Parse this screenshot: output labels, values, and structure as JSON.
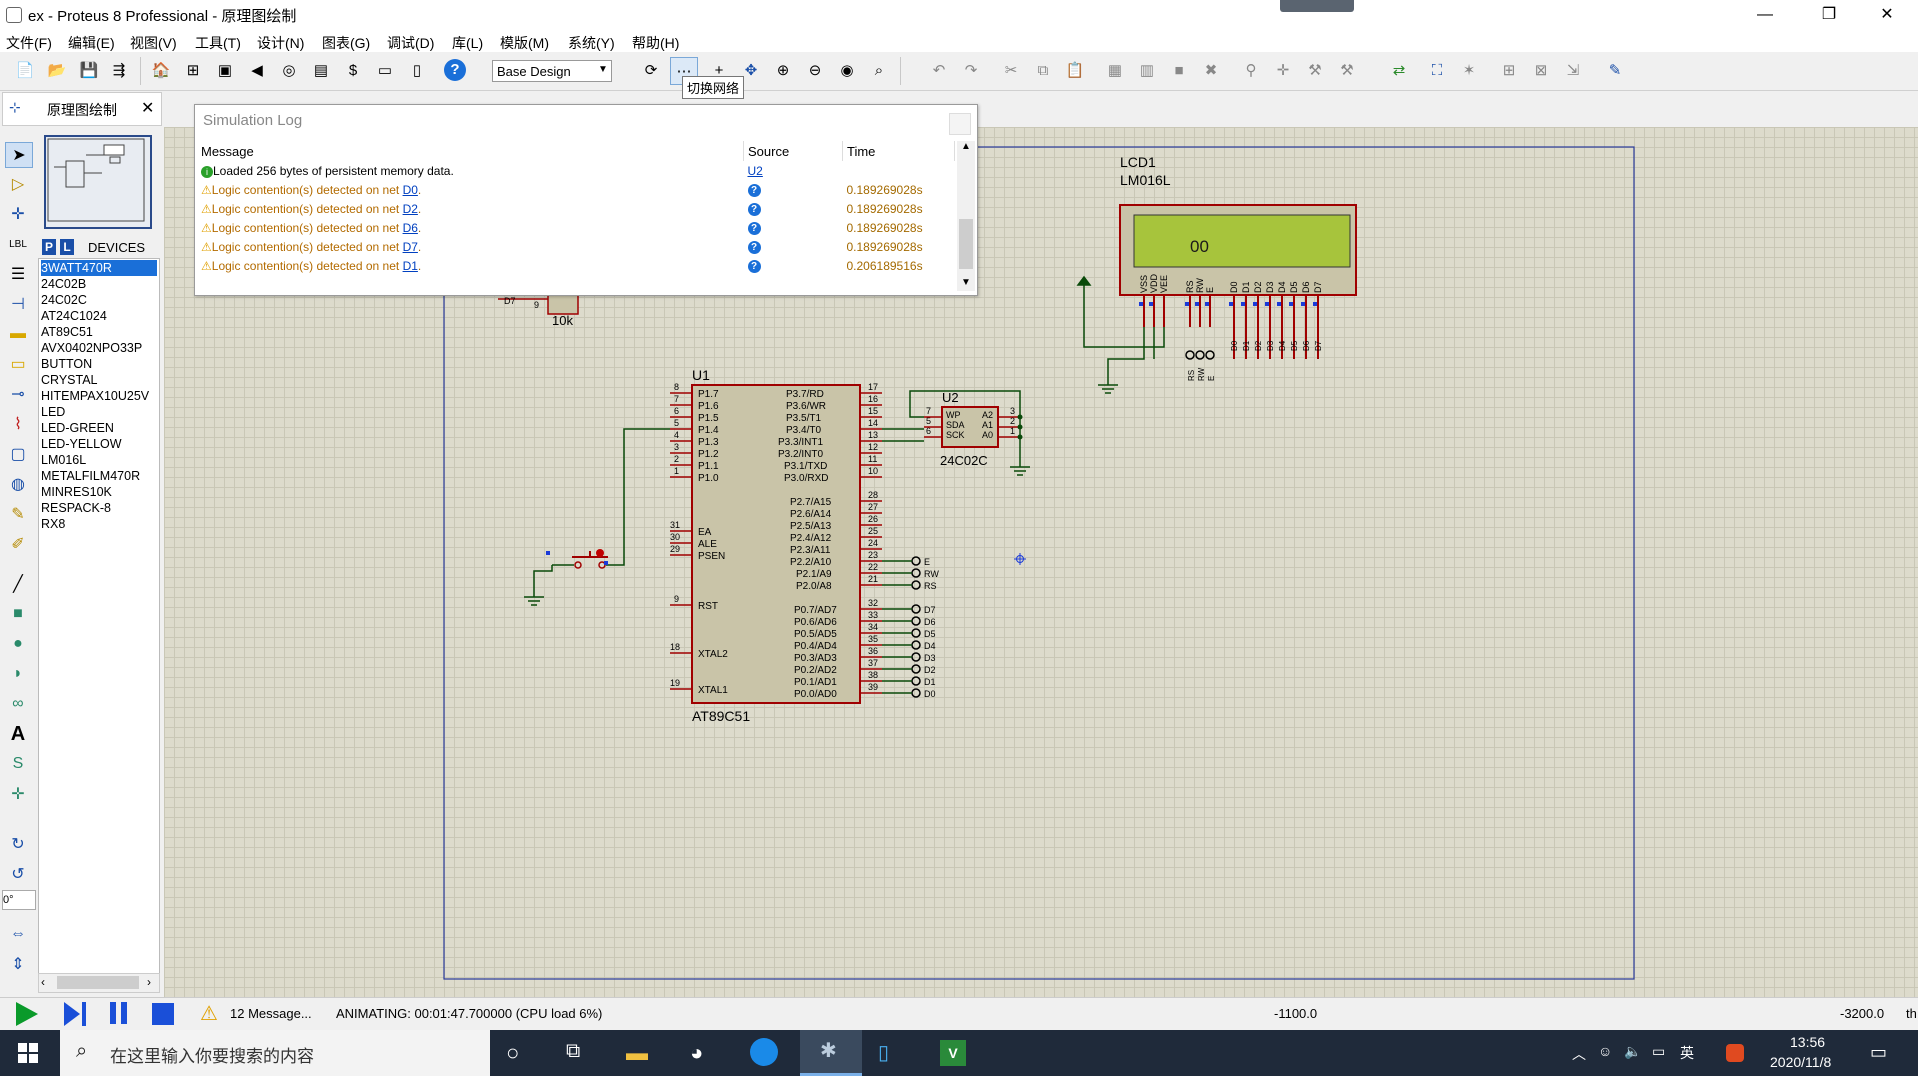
{
  "window": {
    "title": "ex - Proteus 8 Professional - 原理图绘制",
    "minimize": "—",
    "maximize": "❐",
    "close": "✕"
  },
  "menu": [
    "文件(F)",
    "编辑(E)",
    "视图(V)",
    "工具(T)",
    "设计(N)",
    "图表(G)",
    "调试(D)",
    "库(L)",
    "模版(M)",
    "系统(Y)",
    "帮助(H)"
  ],
  "toolbar": {
    "variant": "Base Design",
    "tooltip": "切换网络"
  },
  "tab": {
    "label": "原理图绘制"
  },
  "devices": {
    "header_p": "P",
    "header_l": "L",
    "title": "DEVICES",
    "items": [
      "3WATT470R",
      "24C02B",
      "24C02C",
      "AT24C1024",
      "AT89C51",
      "AVX0402NPO33P",
      "BUTTON",
      "CRYSTAL",
      "HITEMPAX10U25V",
      "LED",
      "LED-GREEN",
      "LED-YELLOW",
      "LM016L",
      "METALFILM470R",
      "MINRES10K",
      "RESPACK-8",
      "RX8"
    ],
    "selected": "3WATT470R"
  },
  "rotation": "0°",
  "simlog": {
    "caption": "Simulation Log",
    "columns": [
      "Message",
      "Source",
      "Time"
    ],
    "rows": [
      {
        "type": "info",
        "text": "Loaded 256 bytes of persistent memory data.",
        "net": "",
        "source": "U2",
        "time": ""
      },
      {
        "type": "warn",
        "text": "Logic contention(s) detected on net ",
        "net": "D0",
        "source": "?",
        "time": "0.189269028s"
      },
      {
        "type": "warn",
        "text": "Logic contention(s) detected on net ",
        "net": "D2",
        "source": "?",
        "time": "0.189269028s"
      },
      {
        "type": "warn",
        "text": "Logic contention(s) detected on net ",
        "net": "D6",
        "source": "?",
        "time": "0.189269028s"
      },
      {
        "type": "warn",
        "text": "Logic contention(s) detected on net ",
        "net": "D7",
        "source": "?",
        "time": "0.189269028s"
      },
      {
        "type": "warn",
        "text": "Logic contention(s) detected on net ",
        "net": "D1",
        "source": "?",
        "time": "0.206189516s"
      }
    ]
  },
  "schematic": {
    "lcd_ref": "LCD1",
    "lcd_part": "LM016L",
    "lcd_display": "00",
    "u1_ref": "U1",
    "u1_part": "AT89C51",
    "u2_ref": "U2",
    "u2_part": "24C02C",
    "resistor_value": "10k"
  },
  "status": {
    "messages": "12 Message...",
    "animating": "ANIMATING: 00:01:47.700000 (CPU load 6%)",
    "coord_x": "-1100.0",
    "coord_y": "-3200.0",
    "unit": "th"
  },
  "taskbar": {
    "search_placeholder": "在这里输入你要搜索的内容",
    "time": "13:56",
    "date": "2020/11/8",
    "ime": "英"
  }
}
